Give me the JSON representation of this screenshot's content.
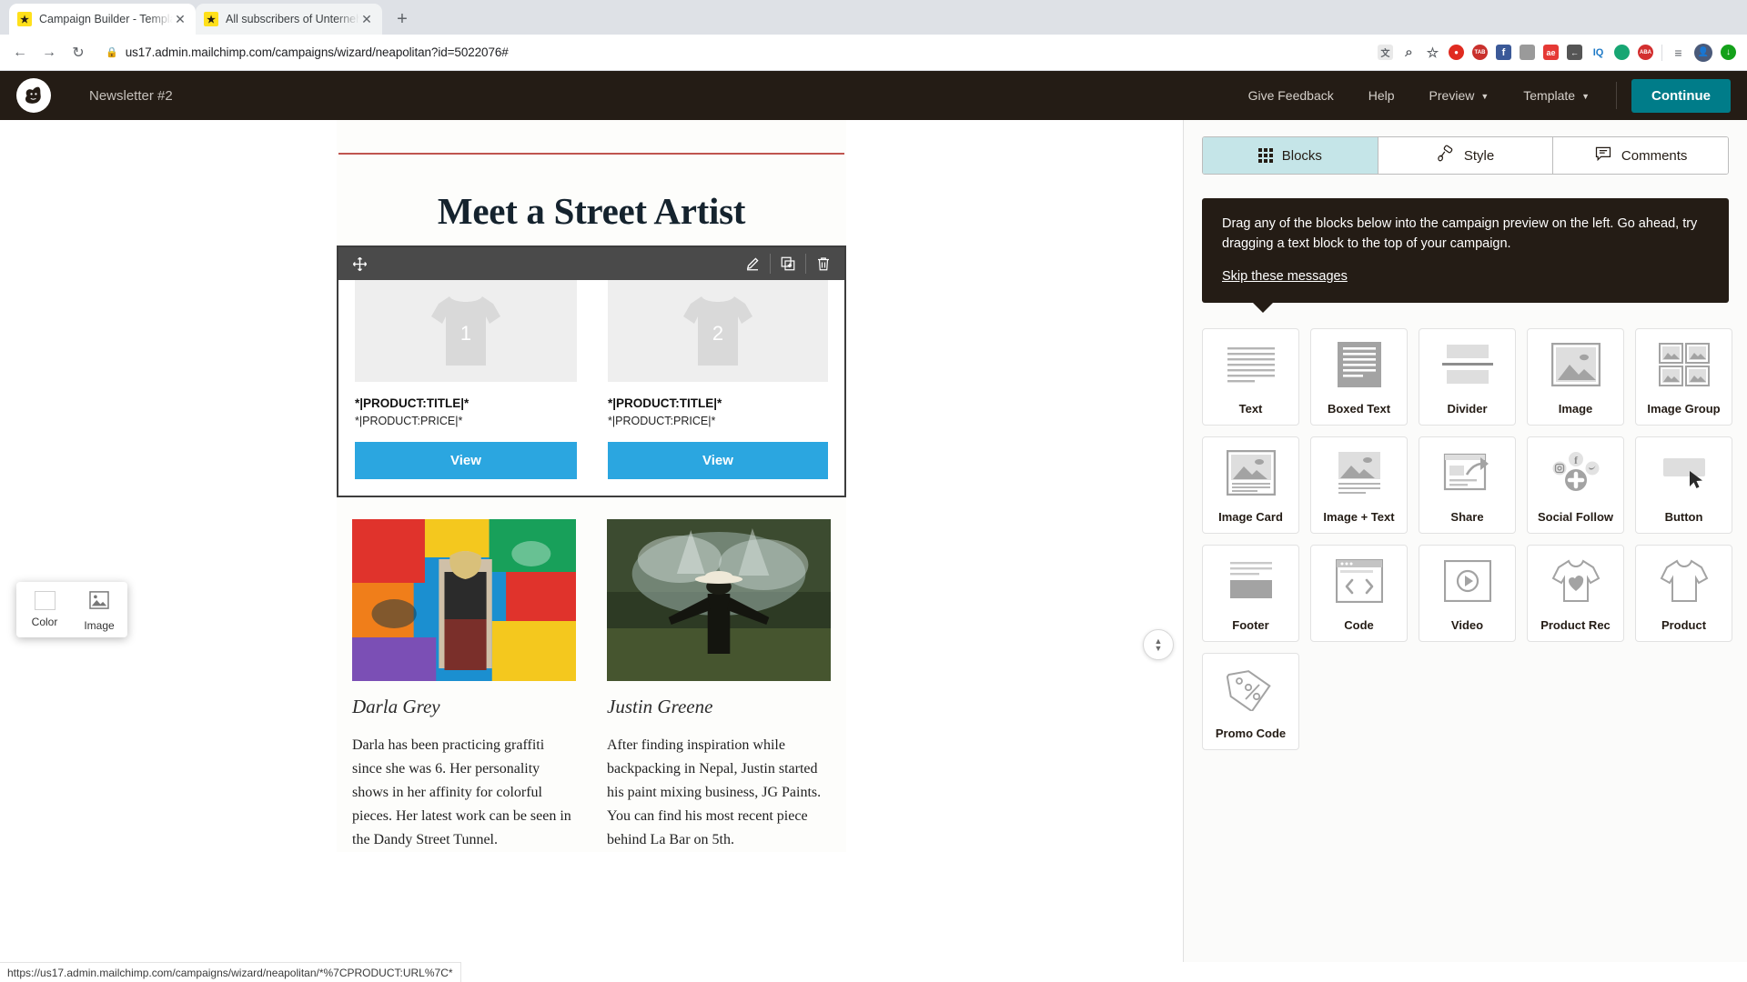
{
  "browser": {
    "tabs": [
      {
        "title": "Campaign Builder - Template D",
        "favicon": "mailchimp-favicon",
        "active": true
      },
      {
        "title": "All subscribers of Unternehme",
        "favicon": "mailchimp-favicon",
        "active": false
      }
    ],
    "new_tab_label": "+",
    "nav": {
      "back": "←",
      "forward": "→",
      "reload": "↻"
    },
    "address": {
      "lock_icon": "lock-icon",
      "url": "us17.admin.mailchimp.com/campaigns/wizard/neapolitan?id=5022076#"
    },
    "extensions": [
      {
        "name": "translate-icon",
        "glyph": "文",
        "bg": "#e8e8e8",
        "fg": "#5f6368"
      },
      {
        "name": "search-icon",
        "glyph": "⌕",
        "bg": "none",
        "fg": "#5f6368"
      },
      {
        "name": "bookmark-star-icon",
        "glyph": "☆",
        "bg": "none",
        "fg": "#5f6368"
      },
      {
        "name": "extension-red-circle",
        "glyph": "",
        "bg": "#e02b20",
        "fg": "#fff"
      },
      {
        "name": "extension-tab-manager",
        "glyph": "TAB",
        "bg": "#c9302c",
        "fg": "#fff"
      },
      {
        "name": "facebook-icon",
        "glyph": "f",
        "bg": "#3b5998",
        "fg": "#fff"
      },
      {
        "name": "extension-grey",
        "glyph": "",
        "bg": "#8b8b8b",
        "fg": "#fff"
      },
      {
        "name": "extension-ae",
        "glyph": "ae",
        "bg": "#e53935",
        "fg": "#fff"
      },
      {
        "name": "extension-pocket",
        "glyph": "←",
        "bg": "#555",
        "fg": "#fff"
      },
      {
        "name": "extension-iq",
        "glyph": "IQ",
        "bg": "none",
        "fg": "#1f7ac7"
      },
      {
        "name": "extension-green-circle",
        "glyph": "",
        "bg": "#17a673",
        "fg": "#fff"
      },
      {
        "name": "extension-aba",
        "glyph": "ABA",
        "bg": "#d32f2f",
        "fg": "#fff"
      },
      {
        "name": "reading-list-icon",
        "glyph": "≡",
        "bg": "none",
        "fg": "#5f6368"
      },
      {
        "name": "profile-avatar",
        "glyph": "",
        "bg": "#4a5a7a",
        "fg": "#fff"
      },
      {
        "name": "extension-green-arrow",
        "glyph": "↓",
        "bg": "#14a11a",
        "fg": "#fff"
      }
    ],
    "status_url": "https://us17.admin.mailchimp.com/campaigns/wizard/neapolitan/*%7CPRODUCT:URL%7C*"
  },
  "mc_header": {
    "logo_name": "mailchimp-logo",
    "campaign_name": "Newsletter #2",
    "links": [
      {
        "label": "Give Feedback",
        "has_caret": false
      },
      {
        "label": "Help",
        "has_caret": false
      },
      {
        "label": "Preview",
        "has_caret": true
      },
      {
        "label": "Template",
        "has_caret": true
      }
    ],
    "caret_glyph": "⌄",
    "continue_label": "Continue",
    "accent_color": "#007c89",
    "bg_color": "#241c15"
  },
  "email_preview": {
    "title": "Meet a Street Artist",
    "divider_color": "#c0554f",
    "block_toolbar": {
      "move_icon": "move-icon",
      "edit_icon": "pencil-icon",
      "duplicate_icon": "duplicate-icon",
      "delete_icon": "trash-icon"
    },
    "products": [
      {
        "placeholder_number": "1",
        "title": "*|PRODUCT:TITLE|*",
        "price": "*|PRODUCT:PRICE|*",
        "button_label": "View"
      },
      {
        "placeholder_number": "2",
        "title": "*|PRODUCT:TITLE|*",
        "price": "*|PRODUCT:PRICE|*",
        "button_label": "View"
      }
    ],
    "button_color": "#2ba6e0",
    "artists": [
      {
        "name": "Darla Grey",
        "photo_name": "graffiti-wall-photo",
        "bio": "Darla has been practicing graffiti since she was 6. Her personality shows in her affinity for colorful pieces. Her latest work can be seen in the Dandy Street Tunnel."
      },
      {
        "name": "Justin Greene",
        "photo_name": "smoke-performance-photo",
        "bio": "After finding inspiration while backpacking in Nepal, Justin started his paint mixing business, JG Paints. You can find his most recent piece behind La Bar on 5th."
      }
    ],
    "color_image_popup": {
      "color_label": "Color",
      "image_label": "Image"
    },
    "collapse_handle_name": "expand-collapse-handle"
  },
  "panel": {
    "tabs": [
      {
        "label": "Blocks",
        "icon": "grid-dots-icon",
        "active": true
      },
      {
        "label": "Style",
        "icon": "paint-roller-icon",
        "active": false
      },
      {
        "label": "Comments",
        "icon": "comment-icon",
        "active": false
      }
    ],
    "tip": {
      "text": "Drag any of the blocks below into the campaign preview on the left. Go ahead, try dragging a text block to the top of your campaign.",
      "skip_label": "Skip these messages"
    },
    "blocks": [
      {
        "label": "Text",
        "icon": "text-lines-icon"
      },
      {
        "label": "Boxed Text",
        "icon": "boxed-text-icon"
      },
      {
        "label": "Divider",
        "icon": "divider-icon"
      },
      {
        "label": "Image",
        "icon": "image-icon"
      },
      {
        "label": "Image Group",
        "icon": "image-group-icon"
      },
      {
        "label": "Image Card",
        "icon": "image-card-icon"
      },
      {
        "label": "Image + Text",
        "icon": "image-text-icon"
      },
      {
        "label": "Share",
        "icon": "share-icon"
      },
      {
        "label": "Social Follow",
        "icon": "social-follow-icon"
      },
      {
        "label": "Button",
        "icon": "button-icon"
      },
      {
        "label": "Footer",
        "icon": "footer-icon"
      },
      {
        "label": "Code",
        "icon": "code-icon"
      },
      {
        "label": "Video",
        "icon": "video-icon"
      },
      {
        "label": "Product Rec",
        "icon": "shirt-heart-icon"
      },
      {
        "label": "Product",
        "icon": "shirt-icon"
      },
      {
        "label": "Promo Code",
        "icon": "promo-tag-icon"
      }
    ]
  }
}
